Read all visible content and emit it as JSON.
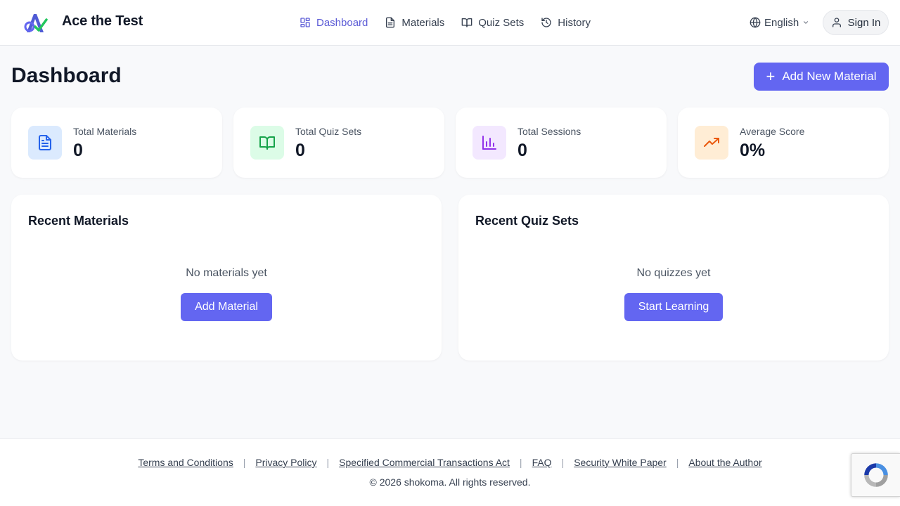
{
  "header": {
    "brand": "Ace the Test",
    "nav": [
      {
        "label": "Dashboard",
        "icon": "dashboard-grid-icon",
        "active": true
      },
      {
        "label": "Materials",
        "icon": "document-icon",
        "active": false
      },
      {
        "label": "Quiz Sets",
        "icon": "book-icon",
        "active": false
      },
      {
        "label": "History",
        "icon": "history-icon",
        "active": false
      }
    ],
    "language": "English",
    "sign_in": "Sign In"
  },
  "page": {
    "title": "Dashboard",
    "add_new_label": "Add New Material"
  },
  "stats": [
    {
      "label": "Total Materials",
      "value": "0",
      "icon": "document-icon",
      "bg": "#dbeafe",
      "fg": "#2563eb"
    },
    {
      "label": "Total Quiz Sets",
      "value": "0",
      "icon": "book-open-icon",
      "bg": "#dcfce7",
      "fg": "#16a34a"
    },
    {
      "label": "Total Sessions",
      "value": "0",
      "icon": "bar-chart-icon",
      "bg": "#f3e8ff",
      "fg": "#9333ea"
    },
    {
      "label": "Average Score",
      "value": "0%",
      "icon": "trending-up-icon",
      "bg": "#ffedd5",
      "fg": "#ea580c"
    }
  ],
  "recent_materials": {
    "title": "Recent Materials",
    "empty": "No materials yet",
    "button": "Add Material"
  },
  "recent_quizzes": {
    "title": "Recent Quiz Sets",
    "empty": "No quizzes yet",
    "button": "Start Learning"
  },
  "footer": {
    "links": [
      "Terms and Conditions",
      "Privacy Policy",
      "Specified Commercial Transactions Act",
      "FAQ",
      "Security White Paper",
      "About the Author"
    ],
    "copyright": "© 2026 shokoma. All rights reserved."
  },
  "colors": {
    "accent": "#6366f1",
    "nav_active": "#5b5bd6"
  }
}
